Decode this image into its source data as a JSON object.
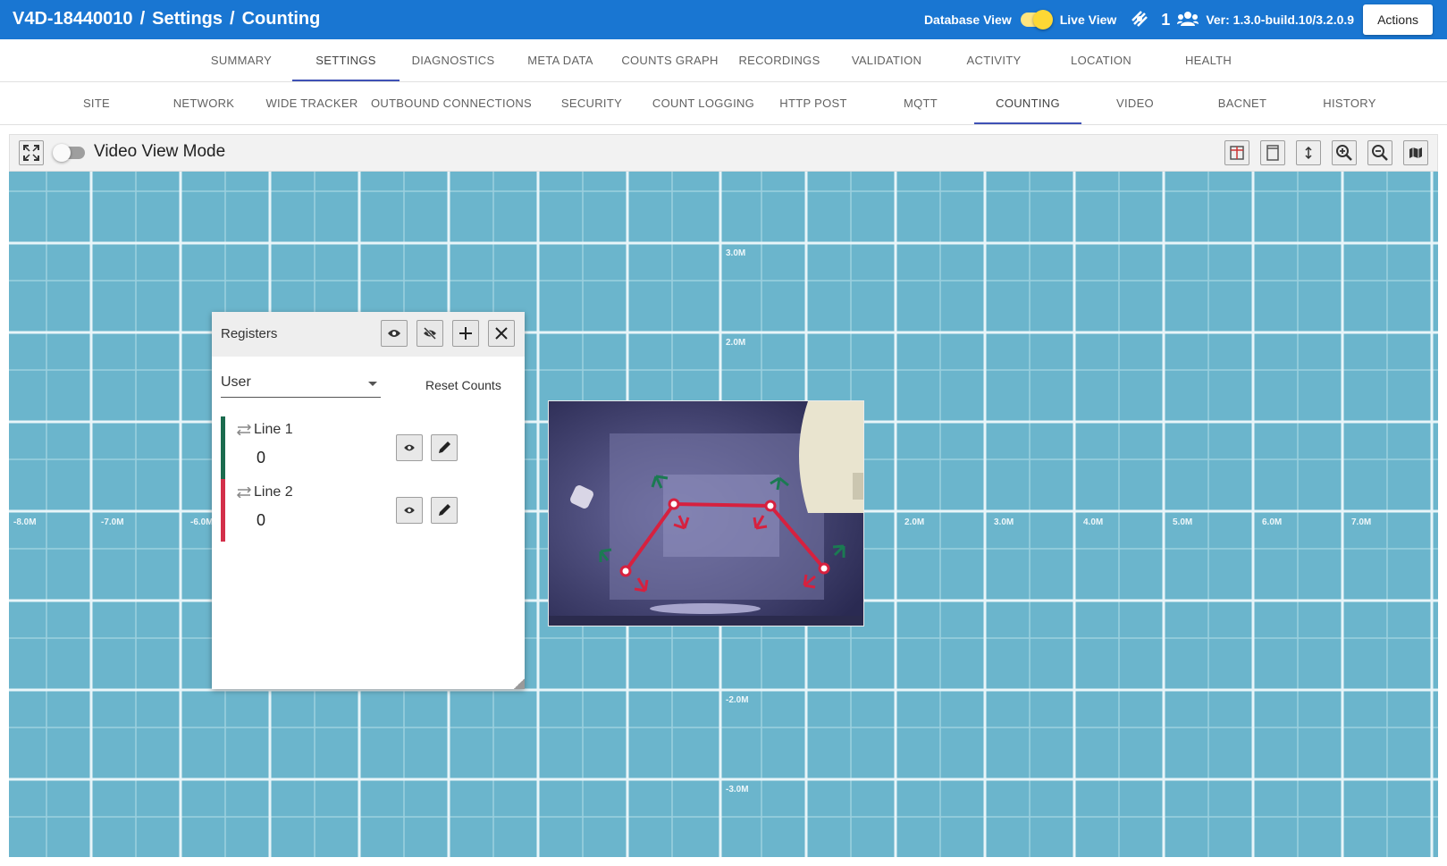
{
  "header": {
    "device_id": "V4D-18440010",
    "crumb_settings": "Settings",
    "crumb_counting": "Counting",
    "separator": "/",
    "database_view_label": "Database View",
    "live_view_label": "Live View",
    "user_count": "1",
    "version": "Ver: 1.3.0-build.10/3.2.0.9",
    "actions_label": "Actions"
  },
  "main_tabs": [
    "SUMMARY",
    "SETTINGS",
    "DIAGNOSTICS",
    "META DATA",
    "COUNTS GRAPH",
    "RECORDINGS",
    "VALIDATION",
    "ACTIVITY",
    "LOCATION",
    "HEALTH"
  ],
  "main_tab_active": "SETTINGS",
  "settings_tabs": [
    "SITE",
    "NETWORK",
    "WIDE TRACKER",
    "OUTBOUND CONNECTIONS",
    "SECURITY",
    "COUNT LOGGING",
    "HTTP POST",
    "MQTT",
    "COUNTING",
    "VIDEO",
    "BACNET",
    "HISTORY"
  ],
  "settings_tab_active": "COUNTING",
  "toolbar": {
    "video_view_mode_label": "Video View Mode",
    "video_view_mode_on": false
  },
  "grid": {
    "x_labels": [
      "-8.0M",
      "-7.0M",
      "-6.0M",
      "2.0M",
      "3.0M",
      "4.0M",
      "5.0M",
      "6.0M",
      "7.0M"
    ],
    "y_labels": [
      "3.0M",
      "2.0M",
      "-2.0M",
      "-3.0M"
    ]
  },
  "registers": {
    "title": "Registers",
    "select_value": "User",
    "reset_label": "Reset Counts",
    "lines": [
      {
        "name": "Line 1",
        "count": "0",
        "color": "#1b6b4e"
      },
      {
        "name": "Line 2",
        "count": "0",
        "color": "#d32f4a"
      }
    ]
  },
  "colors": {
    "header_bg": "#1976d2",
    "grid_bg": "#6bb5cc",
    "line_red": "#d6213f",
    "arrow_green": "#1b7a52"
  }
}
